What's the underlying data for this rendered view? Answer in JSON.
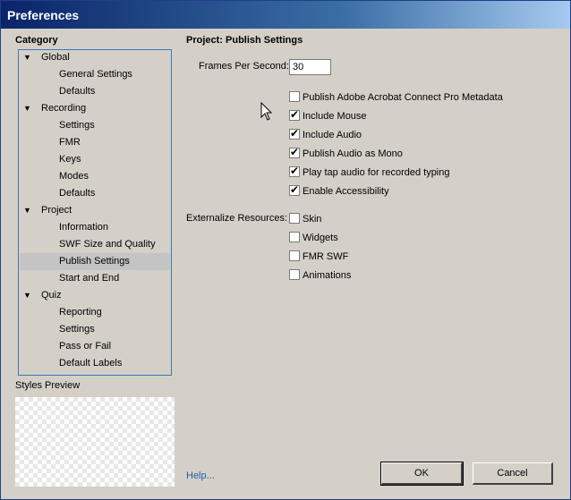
{
  "window": {
    "title": "Preferences"
  },
  "category": {
    "heading": "Category",
    "tree": [
      {
        "label": "Global",
        "expanded": true,
        "level": 0
      },
      {
        "label": "General Settings",
        "level": 1
      },
      {
        "label": "Defaults",
        "level": 1
      },
      {
        "label": "Recording",
        "expanded": true,
        "level": 0
      },
      {
        "label": "Settings",
        "level": 1
      },
      {
        "label": "FMR",
        "level": 1
      },
      {
        "label": "Keys",
        "level": 1
      },
      {
        "label": "Modes",
        "level": 1
      },
      {
        "label": "Defaults",
        "level": 1
      },
      {
        "label": "Project",
        "expanded": true,
        "level": 0
      },
      {
        "label": "Information",
        "level": 1
      },
      {
        "label": "SWF Size and Quality",
        "level": 1
      },
      {
        "label": "Publish Settings",
        "level": 1,
        "selected": true
      },
      {
        "label": "Start and End",
        "level": 1
      },
      {
        "label": "Quiz",
        "expanded": true,
        "level": 0
      },
      {
        "label": "Reporting",
        "level": 1
      },
      {
        "label": "Settings",
        "level": 1
      },
      {
        "label": "Pass or Fail",
        "level": 1
      },
      {
        "label": "Default Labels",
        "level": 1
      }
    ],
    "expand_icon": "triangle-down"
  },
  "styles_preview": {
    "label": "Styles Preview"
  },
  "panel": {
    "title": "Project: Publish Settings",
    "fps_label": "Frames Per Second:",
    "fps_value": "30",
    "options": [
      {
        "label": "Publish Adobe Acrobat Connect Pro Metadata",
        "checked": false
      },
      {
        "label": "Include Mouse",
        "checked": true
      },
      {
        "label": "Include Audio",
        "checked": true
      },
      {
        "label": "Publish Audio as Mono",
        "checked": true
      },
      {
        "label": "Play tap audio for recorded typing",
        "checked": true
      },
      {
        "label": "Enable Accessibility",
        "checked": true
      }
    ],
    "externalize_label": "Externalize Resources:",
    "externalize": [
      {
        "label": "Skin",
        "checked": false
      },
      {
        "label": "Widgets",
        "checked": false
      },
      {
        "label": "FMR SWF",
        "checked": false
      },
      {
        "label": "Animations",
        "checked": false
      }
    ]
  },
  "footer": {
    "help_label": "Help...",
    "ok_label": "OK",
    "cancel_label": "Cancel"
  },
  "colors": {
    "titlebar_start": "#0a246a",
    "selection": "#c4c4c4",
    "link": "#1f5fa6",
    "tree_border": "#3a79b8"
  }
}
